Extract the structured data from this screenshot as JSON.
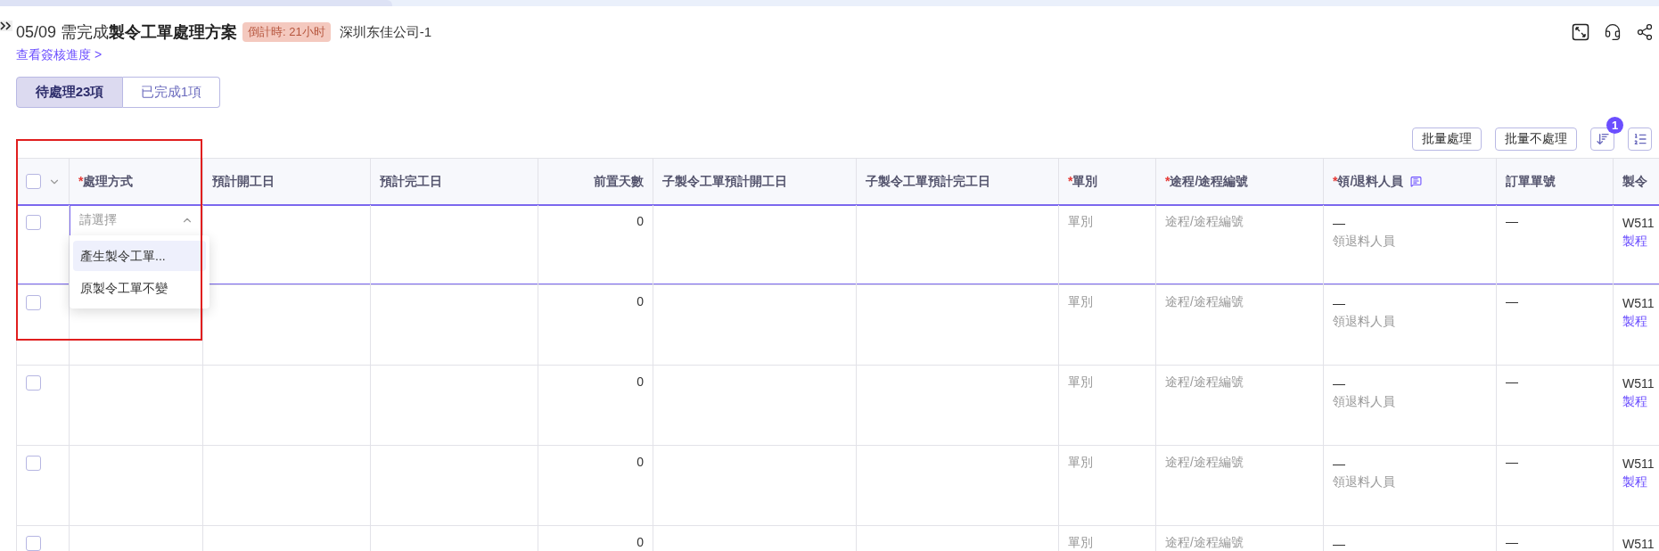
{
  "header": {
    "title": "05/09 需完成**製令工單處理方案**",
    "countdown": "倒計時: 21小时",
    "company": "深圳东佳公司-1",
    "progress_link": "查看簽核進度 >"
  },
  "tabs": [
    {
      "label": "待處理23項",
      "selected": true
    },
    {
      "label": "已完成1項",
      "selected": false
    }
  ],
  "toolbar": {
    "buttons": [
      "批量處理",
      "批量不處理"
    ],
    "filter_badge": "1"
  },
  "table": {
    "select_all_checked": false,
    "columns": [
      {
        "marker": "*",
        "label": "處理方式",
        "kind": "text"
      },
      {
        "label": "預計開工日",
        "kind": "text"
      },
      {
        "label": "預計完工日",
        "kind": "text"
      },
      {
        "label": "前置天數",
        "kind": "number"
      },
      {
        "label": "子製令工單預計開工日",
        "kind": "text"
      },
      {
        "label": "子製令工單預計完工日",
        "kind": "text"
      },
      {
        "marker": "*",
        "label": "單別",
        "kind": "text"
      },
      {
        "marker": "*",
        "label": "途程/途程編號",
        "kind": "text"
      },
      {
        "marker": "*",
        "label": "領/退料人員",
        "kind": "text",
        "note_icon": true
      },
      {
        "label": "訂單單號",
        "kind": "text"
      },
      {
        "label": "製令",
        "kind": "text"
      }
    ],
    "rows": [
      {
        "checked": false,
        "focused": true,
        "method": {
          "placeholder": "請選擇",
          "open": true,
          "options": [
            {
              "label": "產生製令工單...",
              "selected": true
            },
            {
              "label": "原製令工單不變",
              "selected": false
            }
          ]
        },
        "lead_days": "0",
        "order_type": "單別",
        "route": "途程/途程編號",
        "person": "—",
        "person_placeholder": "領退料人員",
        "order_no": "—",
        "mo": "W511",
        "mo_link": "製程"
      },
      {
        "checked": false,
        "focused": false,
        "lead_days": "0",
        "order_type": "單別",
        "route": "途程/途程編號",
        "person": "—",
        "person_placeholder": "領退料人員",
        "order_no": "—",
        "mo": "W511",
        "mo_link": "製程"
      },
      {
        "checked": false,
        "focused": false,
        "lead_days": "0",
        "order_type": "單別",
        "route": "途程/途程編號",
        "person": "—",
        "person_placeholder": "領退料人員",
        "order_no": "—",
        "mo": "W511",
        "mo_link": "製程"
      },
      {
        "checked": false,
        "focused": false,
        "lead_days": "0",
        "order_type": "單別",
        "route": "途程/途程編號",
        "person": "—",
        "person_placeholder": "領退料人員",
        "order_no": "—",
        "mo": "W511",
        "mo_link": "製程"
      },
      {
        "checked": false,
        "focused": false,
        "lead_days": "0",
        "order_type": "單別",
        "route": "途程/途程編號",
        "person": "—",
        "order_no": "—",
        "mo": "W511"
      }
    ]
  }
}
